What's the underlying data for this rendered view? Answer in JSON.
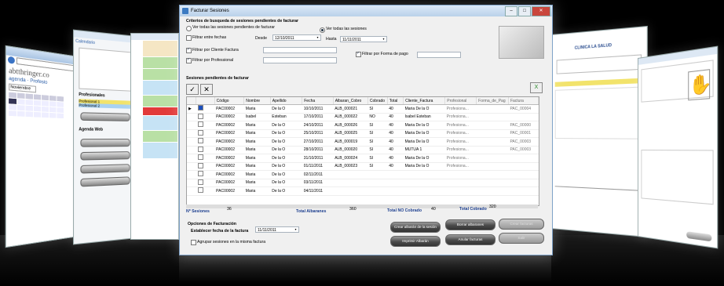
{
  "main": {
    "title": "Facturar Sesiones",
    "criteria_title": "Criterios de busqueda de sesiones pendientes de facturar",
    "radio_all_pending": "Ver todas las sesiones pendientes de facturar",
    "radio_all": "Ver todas las sesiones",
    "filter_dates": "Filtrar entre fechas",
    "from_label": "Desde",
    "from_value": "12/10/2011",
    "to_label": "Hasta",
    "to_value": "11/11/2011",
    "filter_client": "Filtrar por Cliente Factura",
    "filter_payment": "Filtrar por Forma de pago",
    "filter_professional": "Filtrar por Professional",
    "pending_title": "Sesiones pendientes de facturar",
    "columns": [
      "Código",
      "Nombre",
      "Apellido",
      "Fecha",
      "Albaran_Cobro",
      "Cobrado",
      "Total",
      "Cliente_Factura",
      "Profesional",
      "Forma_de_Pag",
      "Factura"
    ],
    "rows": [
      [
        "PAC00002",
        "Maria",
        "De la O",
        "10/10/2011",
        "ALB_000021",
        "SI",
        "40",
        "Maria De la O",
        "Profesiona...",
        "",
        "PAC_00004"
      ],
      [
        "PAC00002",
        "Isabel",
        "Esteban",
        "17/10/2011",
        "ALB_000022",
        "NO",
        "40",
        "Isabel Esteban",
        "Profesiona...",
        "",
        ""
      ],
      [
        "PAC00002",
        "Maria",
        "De la O",
        "24/10/2011",
        "ALB_000026",
        "SI",
        "40",
        "Maria De la O",
        "Profesiona...",
        "",
        "PAC_00000"
      ],
      [
        "PAC00002",
        "Maria",
        "De la O",
        "25/10/2011",
        "ALB_000025",
        "SI",
        "40",
        "Maria De la O",
        "Profesiona...",
        "",
        "PAC_00001"
      ],
      [
        "PAC00002",
        "Maria",
        "De la O",
        "27/10/2011",
        "ALB_000019",
        "SI",
        "40",
        "Maria De la O",
        "Profesiona...",
        "",
        "PAC_00003"
      ],
      [
        "PAC00002",
        "Maria",
        "De la O",
        "28/10/2011",
        "ALB_000020",
        "SI",
        "40",
        "MUTUA 1",
        "Profesiona...",
        "",
        "PAC_00003"
      ],
      [
        "PAC00002",
        "Maria",
        "De la O",
        "31/10/2011",
        "ALB_000024",
        "SI",
        "40",
        "Maria De la O",
        "Profesiona...",
        "",
        ""
      ],
      [
        "PAC00002",
        "Maria",
        "De la O",
        "01/11/2011",
        "ALB_000023",
        "SI",
        "40",
        "Maria De la O",
        "Profesiona...",
        "",
        ""
      ],
      [
        "PAC00002",
        "Maria",
        "De la O",
        "02/11/2011",
        "",
        "",
        "",
        "",
        "",
        "",
        ""
      ],
      [
        "PAC00002",
        "Maria",
        "De la O",
        "03/11/2011",
        "",
        "",
        "",
        "",
        "",
        "",
        ""
      ],
      [
        "PAC00002",
        "Maria",
        "De la O",
        "04/11/2011",
        "",
        "",
        "",
        "",
        "",
        "",
        ""
      ]
    ],
    "nsessions_label": "Nº Sesiones",
    "nsessions_value": "36",
    "total_albaranes_label": "Total Albaranes",
    "total_albaranes_value": "360",
    "total_no_cobrado_label": "Total NO Cobrado",
    "total_no_cobrado_value": "40",
    "total_cobrado_label": "Total Cobrado",
    "total_cobrado_value": "320",
    "billing_options_title": "Opciones de Facturación",
    "billing_date_label": "Establecer fecha de la factura",
    "billing_date_value": "11/11/2011",
    "group_sessions_label": "Agrupar sesiones en la misma factura",
    "btn_crear_albaran": "Crear albarán de la sesión",
    "btn_borrar_albaranes": "Borrar albaranes",
    "btn_crear_facturas": "Crear facturas",
    "btn_imprimir_albaran": "Imprimir Albarán",
    "btn_anular_facturas": "Anular facturas",
    "btn_salir": "Salir"
  },
  "left_browser": {
    "brand": "abtthringer.co",
    "tab_a": "agenda",
    "tab_b": "Profesio",
    "month": "Noviembre"
  },
  "calendar_window": {
    "header": "Calendario",
    "professionals_label": "Profesionales",
    "pro1": "Profesional 1",
    "pro2": "Profesional 2",
    "web_label": "Agenda Web"
  },
  "right_doc": {
    "clinic": "CLINICA LA SALUD"
  }
}
